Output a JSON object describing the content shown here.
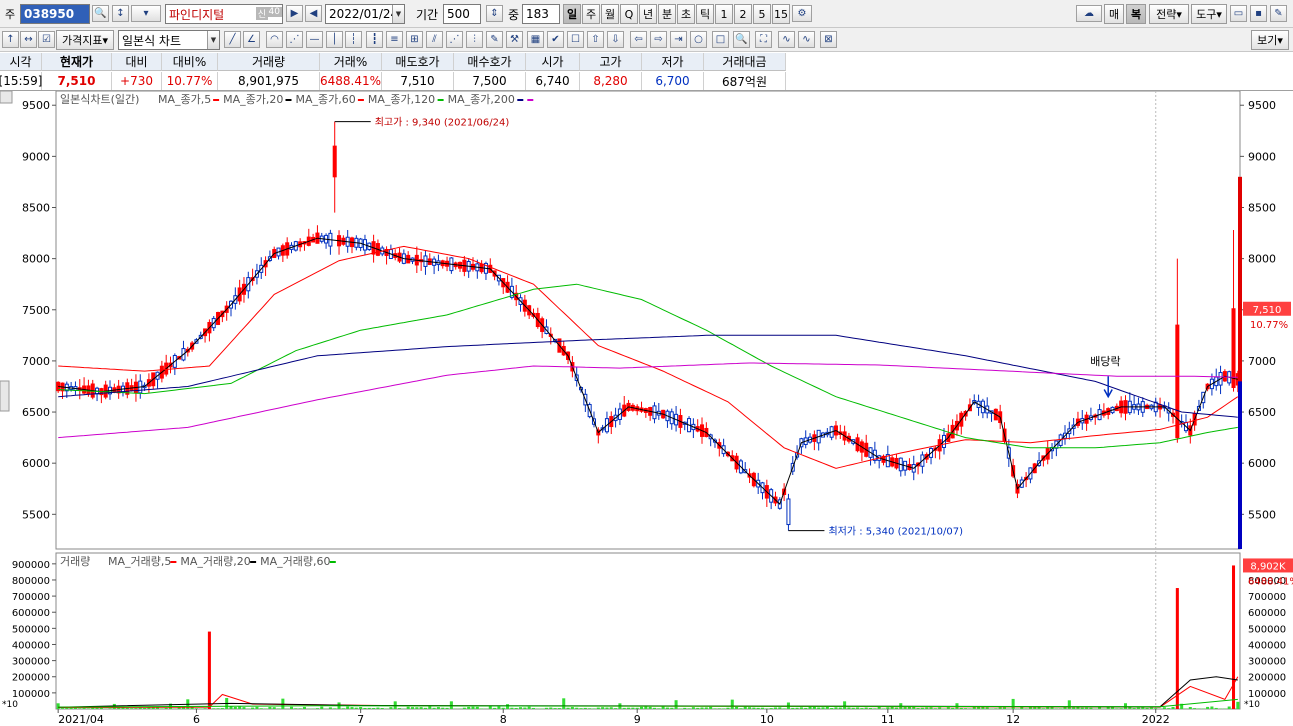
{
  "toolbar": {
    "market_label": "주",
    "code": "038950",
    "name": "파인디지털",
    "credit_badge": "신",
    "margin_badge": "40",
    "date": "2022/01/24",
    "period_label": "기간",
    "period_value": "500",
    "overlap_label": "중",
    "overlap_value": "183",
    "timeframes": [
      "일",
      "주",
      "월",
      "Q",
      "년",
      "분",
      "초",
      "틱",
      "1",
      "2",
      "5",
      "15"
    ],
    "active_timeframe": "일",
    "right_buttons": [
      "매",
      "복",
      "전략",
      "도구"
    ],
    "indicator_label": "가격지표",
    "chart_type": "일본식 차트",
    "view_label": "보기"
  },
  "quote": {
    "headers": [
      "시각",
      "현재가",
      "대비",
      "대비%",
      "거래량",
      "거래%",
      "매도호가",
      "매수호가",
      "시가",
      "고가",
      "저가",
      "거래대금"
    ],
    "values": [
      "[15:59]",
      "7,510",
      "+730",
      "10.77%",
      "8,901,975",
      "6488.41%",
      "7,510",
      "7,500",
      "6,740",
      "8,280",
      "6,700",
      "687억원"
    ]
  },
  "price_panel": {
    "title": "일본식차트(일간)",
    "legend": [
      {
        "label": "MA_종가,5",
        "color": "#ff0000"
      },
      {
        "label": "MA_종가,20",
        "color": "#000000"
      },
      {
        "label": "MA_종가,60",
        "color": "#ff0000"
      },
      {
        "label": "MA_종가,120",
        "color": "#00bb00"
      },
      {
        "label": "MA_종가,200",
        "color": "#000080"
      },
      {
        "label": "",
        "color": "#cc00cc"
      }
    ],
    "high_annotation": "최고가 : 9,340 (2021/06/24)",
    "low_annotation": "최저가 : 5,340 (2021/10/07)",
    "dividend_label": "배당락",
    "last_price_tag": "7,510",
    "last_change_tag": "10.77%"
  },
  "volume_panel": {
    "title": "거래량",
    "legend": [
      {
        "label": "MA_거래량,5",
        "color": "#ff0000"
      },
      {
        "label": "MA_거래량,20",
        "color": "#000000"
      },
      {
        "label": "MA_거래량,60",
        "color": "#00bb00"
      }
    ],
    "last_volume_tag": "8,902K",
    "last_ratio_tag": "6488.41%",
    "unit_label": "*10"
  },
  "colors": {
    "up": "#ff0000",
    "down": "#0030c0",
    "accent": "#3060b8"
  },
  "chart_data": {
    "type": "candlestick",
    "price_axis": {
      "ticks": [
        9500,
        9000,
        8500,
        8000,
        7500,
        7000,
        6500,
        6000,
        5500
      ],
      "min": 5200,
      "max": 9600
    },
    "volume_axis": {
      "ticks": [
        900000,
        800000,
        700000,
        600000,
        500000,
        400000,
        300000,
        200000,
        100000
      ],
      "min": 0,
      "max": 930000
    },
    "x_labels": [
      "2021/04",
      "6",
      "7",
      "8",
      "9",
      "10",
      "11",
      "12",
      "2022"
    ],
    "x_label_index": [
      0,
      32,
      70,
      103,
      134,
      164,
      192,
      221,
      254
    ],
    "series": [
      {
        "name": "MA_종가,5",
        "close_path": [
          [
            0,
            6750
          ],
          [
            10,
            6700
          ],
          [
            20,
            6750
          ],
          [
            30,
            7100
          ],
          [
            40,
            7550
          ],
          [
            50,
            8050
          ],
          [
            60,
            8200
          ],
          [
            70,
            8150
          ],
          [
            80,
            8000
          ],
          [
            90,
            7950
          ],
          [
            100,
            7900
          ],
          [
            110,
            7450
          ],
          [
            118,
            7050
          ],
          [
            125,
            6300
          ],
          [
            132,
            6550
          ],
          [
            140,
            6480
          ],
          [
            150,
            6300
          ],
          [
            160,
            5880
          ],
          [
            167,
            5600
          ],
          [
            172,
            6200
          ],
          [
            180,
            6320
          ],
          [
            190,
            6050
          ],
          [
            198,
            5950
          ],
          [
            206,
            6250
          ],
          [
            212,
            6600
          ],
          [
            218,
            6450
          ],
          [
            222,
            5750
          ],
          [
            228,
            6050
          ],
          [
            236,
            6400
          ],
          [
            246,
            6550
          ],
          [
            256,
            6550
          ],
          [
            262,
            6320
          ],
          [
            266,
            6750
          ],
          [
            270,
            6850
          ],
          [
            273,
            6820
          ]
        ]
      },
      {
        "name": "MA_종가,60",
        "close_path": [
          [
            0,
            6950
          ],
          [
            20,
            6900
          ],
          [
            35,
            6950
          ],
          [
            50,
            7650
          ],
          [
            65,
            7980
          ],
          [
            80,
            8120
          ],
          [
            95,
            8000
          ],
          [
            110,
            7750
          ],
          [
            125,
            7150
          ],
          [
            140,
            6900
          ],
          [
            155,
            6600
          ],
          [
            168,
            6150
          ],
          [
            180,
            5950
          ],
          [
            195,
            6100
          ],
          [
            210,
            6230
          ],
          [
            225,
            6200
          ],
          [
            240,
            6270
          ],
          [
            255,
            6330
          ],
          [
            266,
            6450
          ],
          [
            273,
            6650
          ]
        ]
      },
      {
        "name": "MA_종가,120",
        "close_path": [
          [
            0,
            6720
          ],
          [
            20,
            6680
          ],
          [
            40,
            6780
          ],
          [
            55,
            7100
          ],
          [
            70,
            7300
          ],
          [
            90,
            7450
          ],
          [
            110,
            7700
          ],
          [
            120,
            7750
          ],
          [
            135,
            7600
          ],
          [
            150,
            7300
          ],
          [
            165,
            6950
          ],
          [
            180,
            6650
          ],
          [
            195,
            6450
          ],
          [
            210,
            6250
          ],
          [
            225,
            6150
          ],
          [
            240,
            6150
          ],
          [
            255,
            6200
          ],
          [
            266,
            6300
          ],
          [
            273,
            6350
          ]
        ]
      },
      {
        "name": "MA_종가,200",
        "close_path": [
          [
            0,
            6650
          ],
          [
            30,
            6750
          ],
          [
            60,
            7050
          ],
          [
            90,
            7140
          ],
          [
            120,
            7200
          ],
          [
            150,
            7250
          ],
          [
            180,
            7250
          ],
          [
            210,
            7050
          ],
          [
            240,
            6800
          ],
          [
            260,
            6500
          ],
          [
            273,
            6450
          ]
        ]
      },
      {
        "name": "",
        "close_path": [
          [
            0,
            6250
          ],
          [
            30,
            6350
          ],
          [
            60,
            6620
          ],
          [
            90,
            6860
          ],
          [
            110,
            6950
          ],
          [
            130,
            6930
          ],
          [
            160,
            6980
          ],
          [
            190,
            6960
          ],
          [
            220,
            6900
          ],
          [
            245,
            6850
          ],
          [
            262,
            6850
          ],
          [
            273,
            6840
          ]
        ]
      }
    ]
  }
}
